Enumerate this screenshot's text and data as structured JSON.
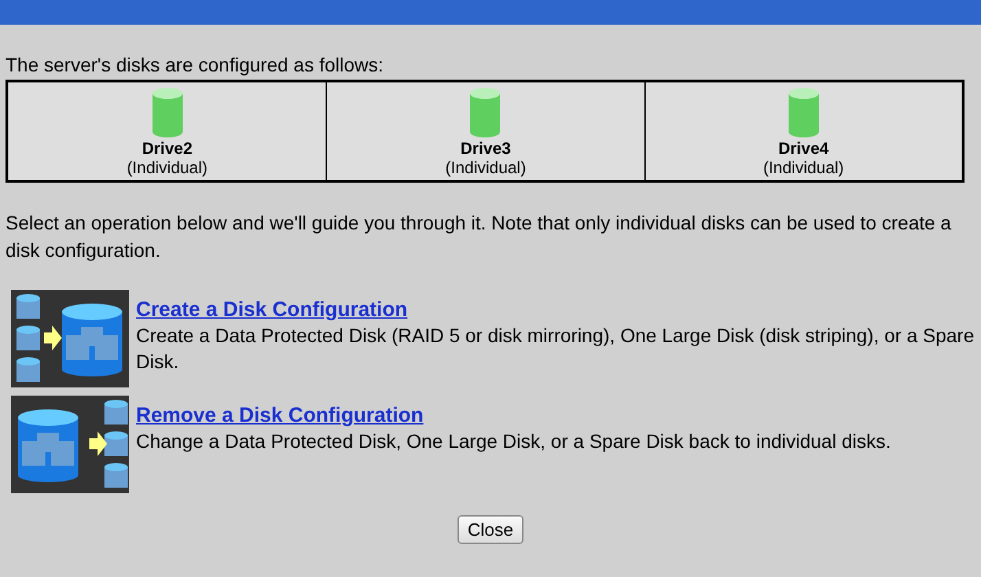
{
  "intro": "The server's disks are configured as follows:",
  "drives": [
    {
      "name": "Drive2",
      "status": "(Individual)"
    },
    {
      "name": "Drive3",
      "status": "(Individual)"
    },
    {
      "name": "Drive4",
      "status": "(Individual)"
    }
  ],
  "instructions": "Select an operation below and we'll guide you through it. Note that only individual disks can be used to create a disk configuration.",
  "operations": [
    {
      "kind": "create",
      "title": "Create a Disk Configuration",
      "description": "Create a Data Protected Disk (RAID 5 or disk mirroring), One Large Disk (disk striping), or a Spare Disk."
    },
    {
      "kind": "remove",
      "title": "Remove a Disk Configuration",
      "description": "Change a Data Protected Disk, One Large Disk, or a Spare Disk back to individual disks."
    }
  ],
  "buttons": [
    "Close"
  ]
}
